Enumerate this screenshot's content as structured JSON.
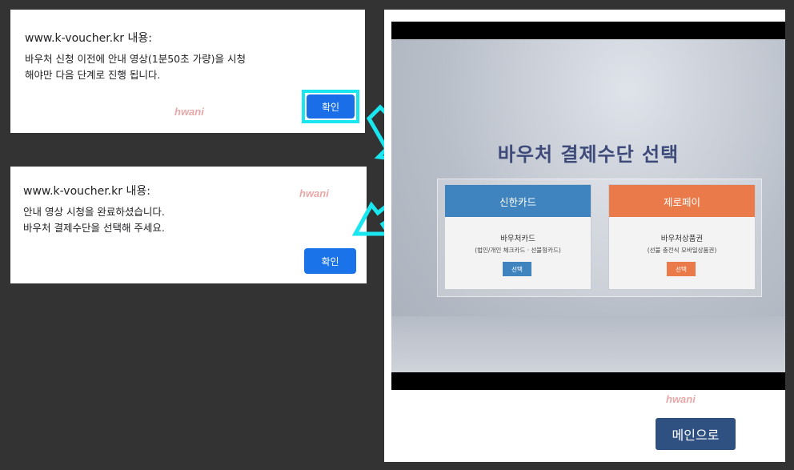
{
  "dialog1": {
    "title": "www.k-voucher.kr 내용:",
    "message": "바우처 신청 이전에 안내 영상(1분50초 가량)을 시청\n해야만 다음 단계로 진행 됩니다.",
    "ok_label": "확인",
    "watermark": "hwani"
  },
  "dialog2": {
    "title": "www.k-voucher.kr 내용:",
    "message": "안내 영상 시청을 완료하셨습니다.\n바우처 결제수단을 선택해 주세요.",
    "ok_label": "확인",
    "watermark": "hwani"
  },
  "video": {
    "heading": "바우처 결제수단 선택",
    "options": [
      {
        "header": "신한카드",
        "title": "바우처카드",
        "subtitle": "(법인/개인 체크카드 · 선불형카드)",
        "button": "선택",
        "color": "#3f84bf"
      },
      {
        "header": "제로페이",
        "title": "바우처상품권",
        "subtitle": "(선불 충전식 모바일상품권)",
        "button": "선택",
        "color": "#ea7a49"
      }
    ]
  },
  "panel": {
    "watermark": "hwani",
    "main_button": "메인으로"
  },
  "colors": {
    "background": "#333333",
    "dialog_button": "#1a73e8",
    "highlight": "#19e6ef",
    "main_button": "#2f5181"
  }
}
